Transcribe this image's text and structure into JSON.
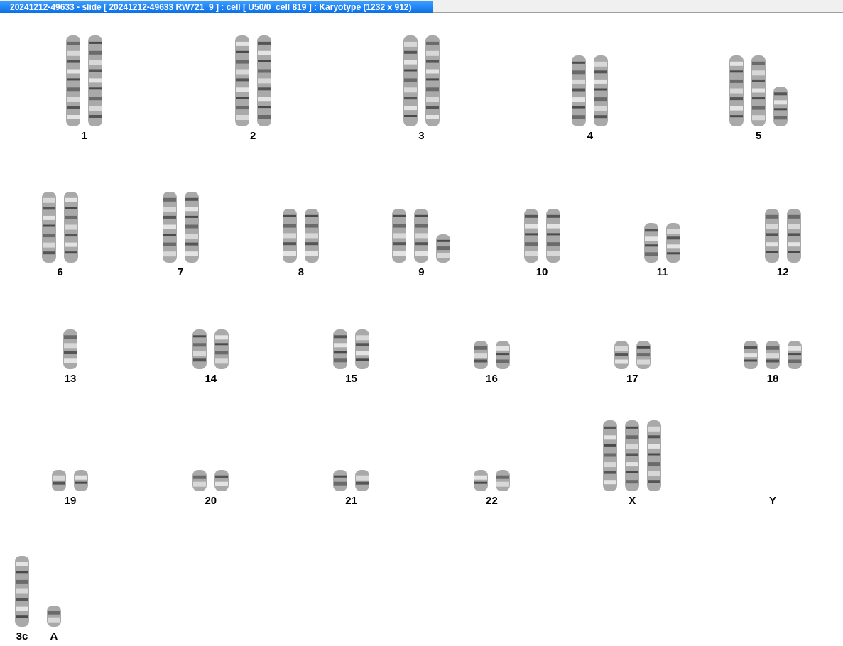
{
  "window": {
    "title": "20241212-49633 - slide [ 20241212-49633 RW721_9 ] : cell [ U50/0_cell 819 ] : Karyotype  (1232 x 912)"
  },
  "karyotype_rows": [
    {
      "groups": [
        {
          "label": "1",
          "chromosomes": [
            {
              "kind": "huge"
            },
            {
              "kind": "huge"
            }
          ]
        },
        {
          "label": "2",
          "chromosomes": [
            {
              "kind": "huge"
            },
            {
              "kind": "huge"
            }
          ]
        },
        {
          "label": "3",
          "chromosomes": [
            {
              "kind": "huge"
            },
            {
              "kind": "huge"
            }
          ]
        },
        {
          "label": "4",
          "chromosomes": [
            {
              "kind": "large"
            },
            {
              "kind": "large"
            }
          ]
        },
        {
          "label": "5",
          "chromosomes": [
            {
              "kind": "large"
            },
            {
              "kind": "large"
            },
            {
              "kind": "small"
            }
          ]
        }
      ]
    },
    {
      "groups": [
        {
          "label": "6",
          "chromosomes": [
            {
              "kind": "large"
            },
            {
              "kind": "large"
            }
          ]
        },
        {
          "label": "7",
          "chromosomes": [
            {
              "kind": "large"
            },
            {
              "kind": "large"
            }
          ]
        },
        {
          "label": "8",
          "chromosomes": [
            {
              "kind": "medium"
            },
            {
              "kind": "medium"
            }
          ]
        },
        {
          "label": "9",
          "chromosomes": [
            {
              "kind": "medium"
            },
            {
              "kind": "medium"
            },
            {
              "kind": "tiny"
            }
          ]
        },
        {
          "label": "10",
          "chromosomes": [
            {
              "kind": "medium"
            },
            {
              "kind": "medium"
            }
          ]
        },
        {
          "label": "11",
          "chromosomes": [
            {
              "kind": "small"
            },
            {
              "kind": "small"
            }
          ]
        },
        {
          "label": "12",
          "chromosomes": [
            {
              "kind": "medium"
            },
            {
              "kind": "medium"
            }
          ]
        }
      ]
    },
    {
      "groups": [
        {
          "label": "13",
          "chromosomes": [
            {
              "kind": "small"
            }
          ]
        },
        {
          "label": "14",
          "chromosomes": [
            {
              "kind": "small"
            },
            {
              "kind": "small"
            }
          ]
        },
        {
          "label": "15",
          "chromosomes": [
            {
              "kind": "small"
            },
            {
              "kind": "small"
            }
          ]
        },
        {
          "label": "16",
          "chromosomes": [
            {
              "kind": "tiny"
            },
            {
              "kind": "tiny"
            }
          ]
        },
        {
          "label": "17",
          "chromosomes": [
            {
              "kind": "tiny"
            },
            {
              "kind": "tiny"
            }
          ]
        },
        {
          "label": "18",
          "chromosomes": [
            {
              "kind": "tiny"
            },
            {
              "kind": "tiny"
            },
            {
              "kind": "tiny"
            }
          ]
        }
      ]
    },
    {
      "groups": [
        {
          "label": "19",
          "chromosomes": [
            {
              "kind": "wee"
            },
            {
              "kind": "wee"
            }
          ]
        },
        {
          "label": "20",
          "chromosomes": [
            {
              "kind": "wee"
            },
            {
              "kind": "wee"
            }
          ]
        },
        {
          "label": "21",
          "chromosomes": [
            {
              "kind": "wee"
            },
            {
              "kind": "wee"
            }
          ]
        },
        {
          "label": "22",
          "chromosomes": [
            {
              "kind": "wee"
            },
            {
              "kind": "wee"
            }
          ]
        },
        {
          "label": "X",
          "chromosomes": [
            {
              "kind": "large"
            },
            {
              "kind": "large"
            },
            {
              "kind": "large"
            }
          ]
        },
        {
          "label": "Y"
        }
      ]
    },
    {
      "groups": [
        {
          "label": "3c",
          "chromosomes": [
            {
              "kind": "large"
            }
          ]
        },
        {
          "label": "A",
          "chromosomes": [
            {
              "kind": "wee"
            }
          ]
        }
      ]
    }
  ]
}
